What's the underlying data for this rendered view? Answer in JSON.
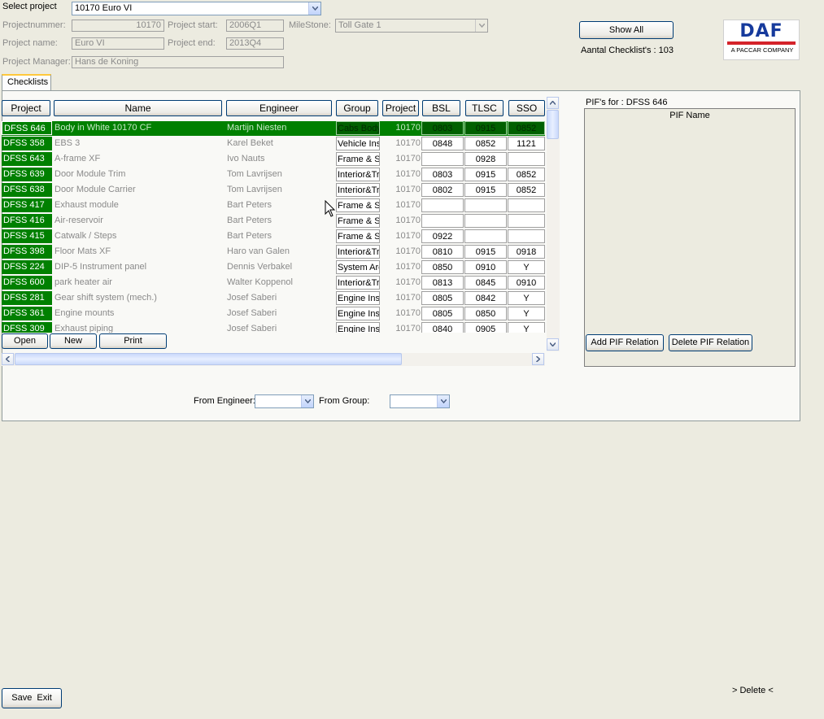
{
  "project_select": {
    "label": "Select project",
    "value": "10170 Euro VI"
  },
  "info": {
    "projectnummer_label": "Projectnummer:",
    "projectnummer": "10170",
    "project_start_label": "Project start:",
    "project_start": "2006Q1",
    "milestone_label": "MileStone:",
    "milestone": "Toll Gate 1",
    "project_name_label": "Project name:",
    "project_name": "Euro VI",
    "project_end_label": "Project end:",
    "project_end": "2013Q4",
    "manager_label": "Project Manager:",
    "manager": "Hans de Koning"
  },
  "show_all": "Show All",
  "checklist_count": "Aantal Checklist's : 103",
  "logo": {
    "text": "DAF",
    "sub": "A PACCAR COMPANY",
    "color": "#163a9c",
    "stripe": "#d4232a"
  },
  "tab": "Checklists",
  "grid": {
    "headers": [
      "Project",
      "Name",
      "Engineer",
      "Group",
      "Project",
      "BSL",
      "TLSC",
      "SSO"
    ],
    "rows": [
      [
        "DFSS 646",
        "Body in White 10170 CF",
        "Martijn Niesten",
        "Cabs Body",
        "10170",
        "0803",
        "0915",
        "0852"
      ],
      [
        "DFSS 358",
        "EBS 3",
        "Karel Beket",
        "Vehicle Ins",
        "10170",
        "0848",
        "0852",
        "1121"
      ],
      [
        "DFSS 643",
        "A-frame XF",
        "Ivo Nauts",
        "Frame & Su",
        "10170",
        "",
        "0928",
        ""
      ],
      [
        "DFSS 639",
        "Door Module Trim",
        "Tom Lavrijsen",
        "Interior&Tri",
        "10170",
        "0803",
        "0915",
        "0852"
      ],
      [
        "DFSS 638",
        "Door Module Carrier",
        "Tom Lavrijsen",
        "Interior&Tri",
        "10170",
        "0802",
        "0915",
        "0852"
      ],
      [
        "DFSS 417",
        "Exhaust module",
        "Bart Peters",
        "Frame & Su",
        "10170",
        "",
        "",
        ""
      ],
      [
        "DFSS 416",
        "Air-reservoir",
        "Bart Peters",
        "Frame & Su",
        "10170",
        "",
        "",
        ""
      ],
      [
        "DFSS 415",
        "Catwalk / Steps",
        "Bart Peters",
        "Frame & Su",
        "10170",
        "0922",
        "",
        ""
      ],
      [
        "DFSS 398",
        "Floor Mats XF",
        "Haro van Galen",
        "Interior&Tri",
        "10170",
        "0810",
        "0915",
        "0918"
      ],
      [
        "DFSS 224",
        "DIP-5 Instrument panel",
        "Dennis Verbakel",
        "System Arc",
        "10170",
        "0850",
        "0910",
        "Y"
      ],
      [
        "DFSS 600",
        "park heater air",
        "Walter Koppenol",
        "Interior&Tri",
        "10170",
        "0813",
        "0845",
        "0910"
      ],
      [
        "DFSS 281",
        "Gear shift system (mech.)",
        "Josef Saberi",
        "Engine Ins",
        "10170",
        "0805",
        "0842",
        "Y"
      ],
      [
        "DFSS 361",
        "Engine mounts",
        "Josef Saberi",
        "Engine Ins",
        "10170",
        "0805",
        "0850",
        "Y"
      ],
      [
        "DFSS 309",
        "Exhaust piping",
        "Josef Saberi",
        "Engine Ins",
        "10170",
        "0840",
        "0905",
        "Y"
      ]
    ]
  },
  "buttons": {
    "open": "Open",
    "new": "New",
    "print": "Print"
  },
  "pif": {
    "title": "PIF's for : DFSS 646",
    "column": "PIF Name",
    "add": "Add PIF Relation",
    "delete": "Delete PIF Relation"
  },
  "filters": {
    "engineer_label": "From Engineer:",
    "group_label": "From Group:",
    "engineer_value": "",
    "group_value": ""
  },
  "footer": {
    "save_exit": "Save  Exit",
    "delete": "> Delete <"
  }
}
